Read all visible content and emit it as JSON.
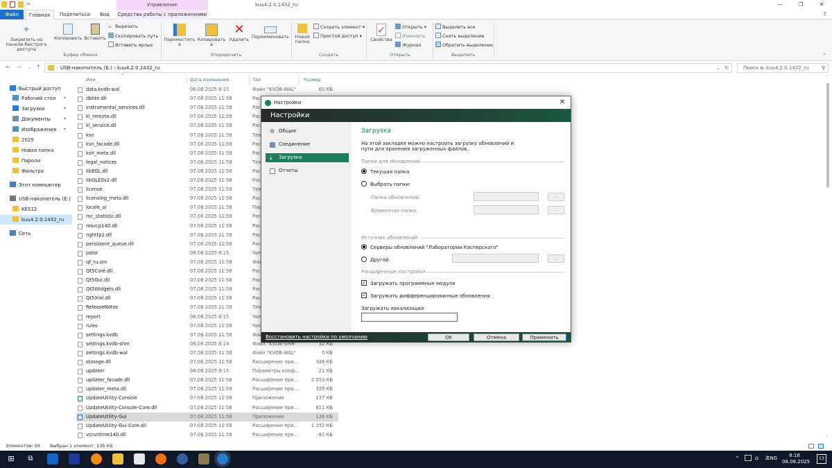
{
  "window": {
    "title": "kuu4.2.0.1432_ru",
    "context_tab": "Управление",
    "controls": [
      "—",
      "❐",
      "✕"
    ]
  },
  "tabs": [
    "Файл",
    "Главная",
    "Поделиться",
    "Вид",
    "Средства работы с приложениями"
  ],
  "ribbon": {
    "clipboard": {
      "pin": "Закрепить на панели быстрого доступа",
      "copy": "Копировать",
      "paste": "Вставить",
      "cut": "Вырезать",
      "copy_path": "Скопировать путь",
      "paste_shortcut": "Вставить ярлык",
      "label": "Буфер обмена"
    },
    "organize": {
      "move": "Переместить в",
      "copy_to": "Копировать в",
      "delete": "Удалить",
      "rename": "Переименовать",
      "label": "Упорядочить"
    },
    "new": {
      "new_folder": "Новая папка",
      "new_item": "Создать элемент",
      "easy_access": "Простой доступ",
      "label": "Создать"
    },
    "open": {
      "properties": "Свойства",
      "open": "Открыть",
      "edit": "Изменить",
      "history": "Журнал",
      "label": "Открыть"
    },
    "select": {
      "select_all": "Выделить все",
      "select_none": "Снять выделение",
      "invert": "Обратить выделение",
      "label": "Выделить"
    }
  },
  "address": {
    "path": "USB-накопитель (E:)  ›  kuu4.2.0.1432_ru",
    "search_placeholder": "Поиск в: kuu4.2.0.1432_ru"
  },
  "sidebar": [
    {
      "label": "Быстрый доступ",
      "pinned": false,
      "color": "#2b7cd3"
    },
    {
      "label": "Рабочий стол",
      "pinned": true,
      "color": "#4a90d9"
    },
    {
      "label": "Загрузки",
      "pinned": true,
      "color": "#2b7cd3"
    },
    {
      "label": "Документы",
      "pinned": true,
      "color": "#7a8ea8"
    },
    {
      "label": "Изображения",
      "pinned": true,
      "color": "#5a8fc6"
    },
    {
      "label": "2025",
      "pinned": false,
      "color": "#f0c040"
    },
    {
      "label": "Новая папка",
      "pinned": false,
      "color": "#f0c040"
    },
    {
      "label": "Пароли",
      "pinned": false,
      "color": "#f0c040"
    },
    {
      "label": "Фильтра",
      "pinned": false,
      "color": "#f0c040"
    },
    {
      "label": "Этот компьютер",
      "pinned": false,
      "color": "#4a7fb8"
    },
    {
      "label": "USB-накопитель (E:)",
      "pinned": false,
      "color": "#777777"
    },
    {
      "label": "KES12",
      "pinned": false,
      "color": "#f0c040"
    },
    {
      "label": "kuu4.2.0.1432_ru",
      "pinned": false,
      "color": "#f0c040"
    },
    {
      "label": "Сеть",
      "pinned": false,
      "color": "#4a7fb8"
    }
  ],
  "columns": {
    "name": "Имя",
    "date": "Дата изменения",
    "type": "Тип",
    "size": "Размер"
  },
  "files": [
    {
      "name": "data.kvdb-wal",
      "date": "08.08.2025 8:15",
      "type": "Файл \"KVDB-WAL\"",
      "size": "65 КБ"
    },
    {
      "name": "dblite.dll",
      "date": "07.08.2025 11:58",
      "type": "Расш",
      "size": ""
    },
    {
      "name": "instrumental_services.dll",
      "date": "07.08.2025 11:58",
      "type": "Расш",
      "size": ""
    },
    {
      "name": "kl_remote.dll",
      "date": "07.08.2025 11:58",
      "type": "Расш",
      "size": ""
    },
    {
      "name": "kl_service.dll",
      "date": "07.08.2025 11:58",
      "type": "Расш",
      "size": ""
    },
    {
      "name": "ksn",
      "date": "07.08.2025 11:58",
      "type": "Текс",
      "size": ""
    },
    {
      "name": "ksn_facade.dll",
      "date": "07.08.2025 11:58",
      "type": "Расш",
      "size": ""
    },
    {
      "name": "ksn_meta.dll",
      "date": "07.08.2025 11:58",
      "type": "Расш",
      "size": ""
    },
    {
      "name": "legal_notices",
      "date": "07.08.2025 11:58",
      "type": "Текс",
      "size": ""
    },
    {
      "name": "libEGL.dll",
      "date": "07.08.2025 11:58",
      "type": "Расш",
      "size": ""
    },
    {
      "name": "libGLESv2.dll",
      "date": "07.08.2025 11:58",
      "type": "Расш",
      "size": ""
    },
    {
      "name": "license",
      "date": "07.08.2025 11:58",
      "type": "Текс",
      "size": ""
    },
    {
      "name": "licensing_meta.dll",
      "date": "07.08.2025 11:58",
      "type": "Расш",
      "size": ""
    },
    {
      "name": "locale_ui",
      "date": "07.08.2025 11:58",
      "type": "Пара",
      "size": ""
    },
    {
      "name": "mc_statistic.dll",
      "date": "07.08.2025 11:58",
      "type": "Расш",
      "size": ""
    },
    {
      "name": "msvcp140.dll",
      "date": "07.08.2025 11:58",
      "type": "Расш",
      "size": ""
    },
    {
      "name": "nghttp2.dll",
      "date": "07.08.2025 11:58",
      "type": "Расш",
      "size": ""
    },
    {
      "name": "persistent_queue.dll",
      "date": "07.08.2025 11:58",
      "type": "Расш",
      "size": ""
    },
    {
      "name": "pstor",
      "date": "08.08.2025 8:15",
      "type": "Yam",
      "size": ""
    },
    {
      "name": "qt_ru.qm",
      "date": "07.08.2025 11:58",
      "type": "Файл",
      "size": ""
    },
    {
      "name": "Qt5Core.dll",
      "date": "07.08.2025 11:58",
      "type": "Расш",
      "size": ""
    },
    {
      "name": "Qt5Gui.dll",
      "date": "07.08.2025 11:58",
      "type": "Расш",
      "size": ""
    },
    {
      "name": "Qt5Widgets.dll",
      "date": "07.08.2025 11:58",
      "type": "Расш",
      "size": ""
    },
    {
      "name": "Qt5Xml.dll",
      "date": "07.08.2025 11:58",
      "type": "Расш",
      "size": ""
    },
    {
      "name": "ReleaseNotes",
      "date": "07.08.2025 11:58",
      "type": "Текс",
      "size": ""
    },
    {
      "name": "report",
      "date": "08.08.2025 8:15",
      "type": "Yam",
      "size": ""
    },
    {
      "name": "rules",
      "date": "07.08.2025 11:58",
      "type": "Yam",
      "size": ""
    },
    {
      "name": "settings.kvdb",
      "date": "07.08.2025 11:58",
      "type": "Файл",
      "size": ""
    },
    {
      "name": "settings.kvdb-shm",
      "date": "08.08.2025 8:14",
      "type": "Файл \"KVDB-SHM\"",
      "size": "32 КБ"
    },
    {
      "name": "settings.kvdb-wal",
      "date": "07.08.2025 11:58",
      "type": "Файл \"KVDB-WAL\"",
      "size": "0 КБ"
    },
    {
      "name": "storage.dll",
      "date": "07.08.2025 11:58",
      "type": "Расширение при...",
      "size": "338 КБ"
    },
    {
      "name": "updater",
      "date": "08.08.2025 8:15",
      "type": "Параметры конф...",
      "size": "21 КБ"
    },
    {
      "name": "updater_facade.dll",
      "date": "07.08.2025 11:58",
      "type": "Расширение при...",
      "size": "2 053 КБ"
    },
    {
      "name": "updater_meta.dll",
      "date": "07.08.2025 11:58",
      "type": "Расширение при...",
      "size": "329 КБ"
    },
    {
      "name": "UpdateUtility-Console",
      "date": "07.08.2025 11:58",
      "type": "Приложение",
      "size": "137 КБ"
    },
    {
      "name": "UpdateUtility-Console-Core.dll",
      "date": "07.08.2025 11:58",
      "type": "Расширение при...",
      "size": "811 КБ"
    },
    {
      "name": "UpdateUtility-Gui",
      "date": "07.08.2025 11:58",
      "type": "Приложение",
      "size": "136 КБ"
    },
    {
      "name": "UpdateUtility-Gui-Core.dll",
      "date": "07.08.2025 11:58",
      "type": "Расширение при...",
      "size": "1 352 КБ"
    },
    {
      "name": "vcruntime140.dll",
      "date": "07.08.2025 11:58",
      "type": "Расширение при...",
      "size": "82 КБ"
    }
  ],
  "selected_file_index": 36,
  "status": {
    "count": "Элементов: 56",
    "selected": "Выбран 1 элемент: 135 КБ"
  },
  "dialog": {
    "window_title": "Настройки",
    "header": "Настройки",
    "nav": [
      "Общие",
      "Соединение",
      "Загрузка",
      "Отчеты"
    ],
    "active_nav": 2,
    "section_title": "Загрузка",
    "description_line1": "На этой закладке можно настроить загрузку обновлений и",
    "description_line2": "пути для хранения загруженных файлов.",
    "folders_group": "Папки для обновлений",
    "current_folder": "Текущая папка",
    "choose_folder": "Выбрать папки:",
    "updates_folder_label": "Папка обновлений:",
    "temp_folder_label": "Временная папка:",
    "browse": "...",
    "source_group": "Источник обновлений",
    "kaspersky_servers": "Серверы обновлений \"Лаборатории Касперского\"",
    "other": "Другой:",
    "advanced_group": "Расширенные настройки",
    "download_modules": "Загружать программные модули",
    "download_diff": "Загружать дифференцированные обновления",
    "localization_label": "Загружать локализации",
    "localization_value": "",
    "restore_defaults": "Восстановить настройки по умолчанию",
    "ok": "OK",
    "cancel": "Отмена",
    "apply": "Применить"
  },
  "taskbar": {
    "lang": "ENG",
    "time": "8:16",
    "date": "08.08.2025",
    "notif": "13"
  }
}
